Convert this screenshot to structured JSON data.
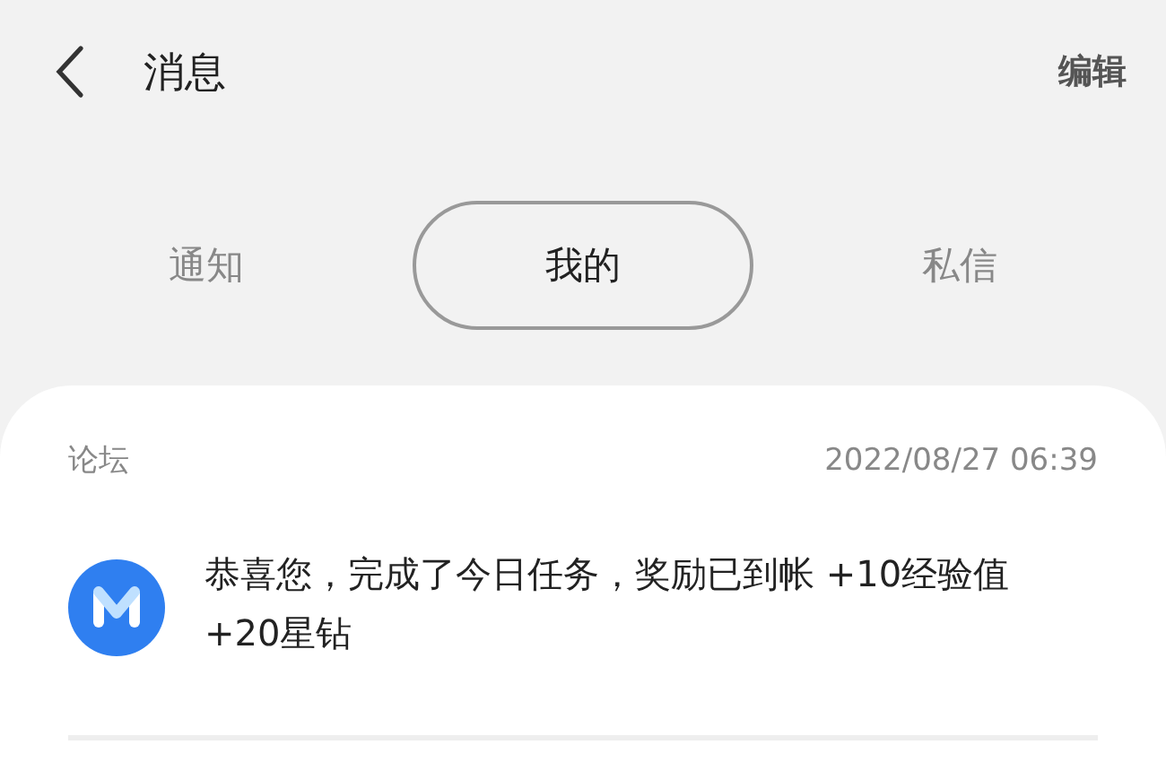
{
  "header": {
    "title": "消息",
    "action": "编辑"
  },
  "tabs": [
    {
      "label": "通知",
      "selected": false
    },
    {
      "label": "我的",
      "selected": true
    },
    {
      "label": "私信",
      "selected": false
    }
  ],
  "messages": [
    {
      "source": "论坛",
      "time": "2022/08/27 06:39",
      "text": "恭喜您，完成了今日任务，奖励已到帐 +10经验值 +20星钻"
    }
  ]
}
